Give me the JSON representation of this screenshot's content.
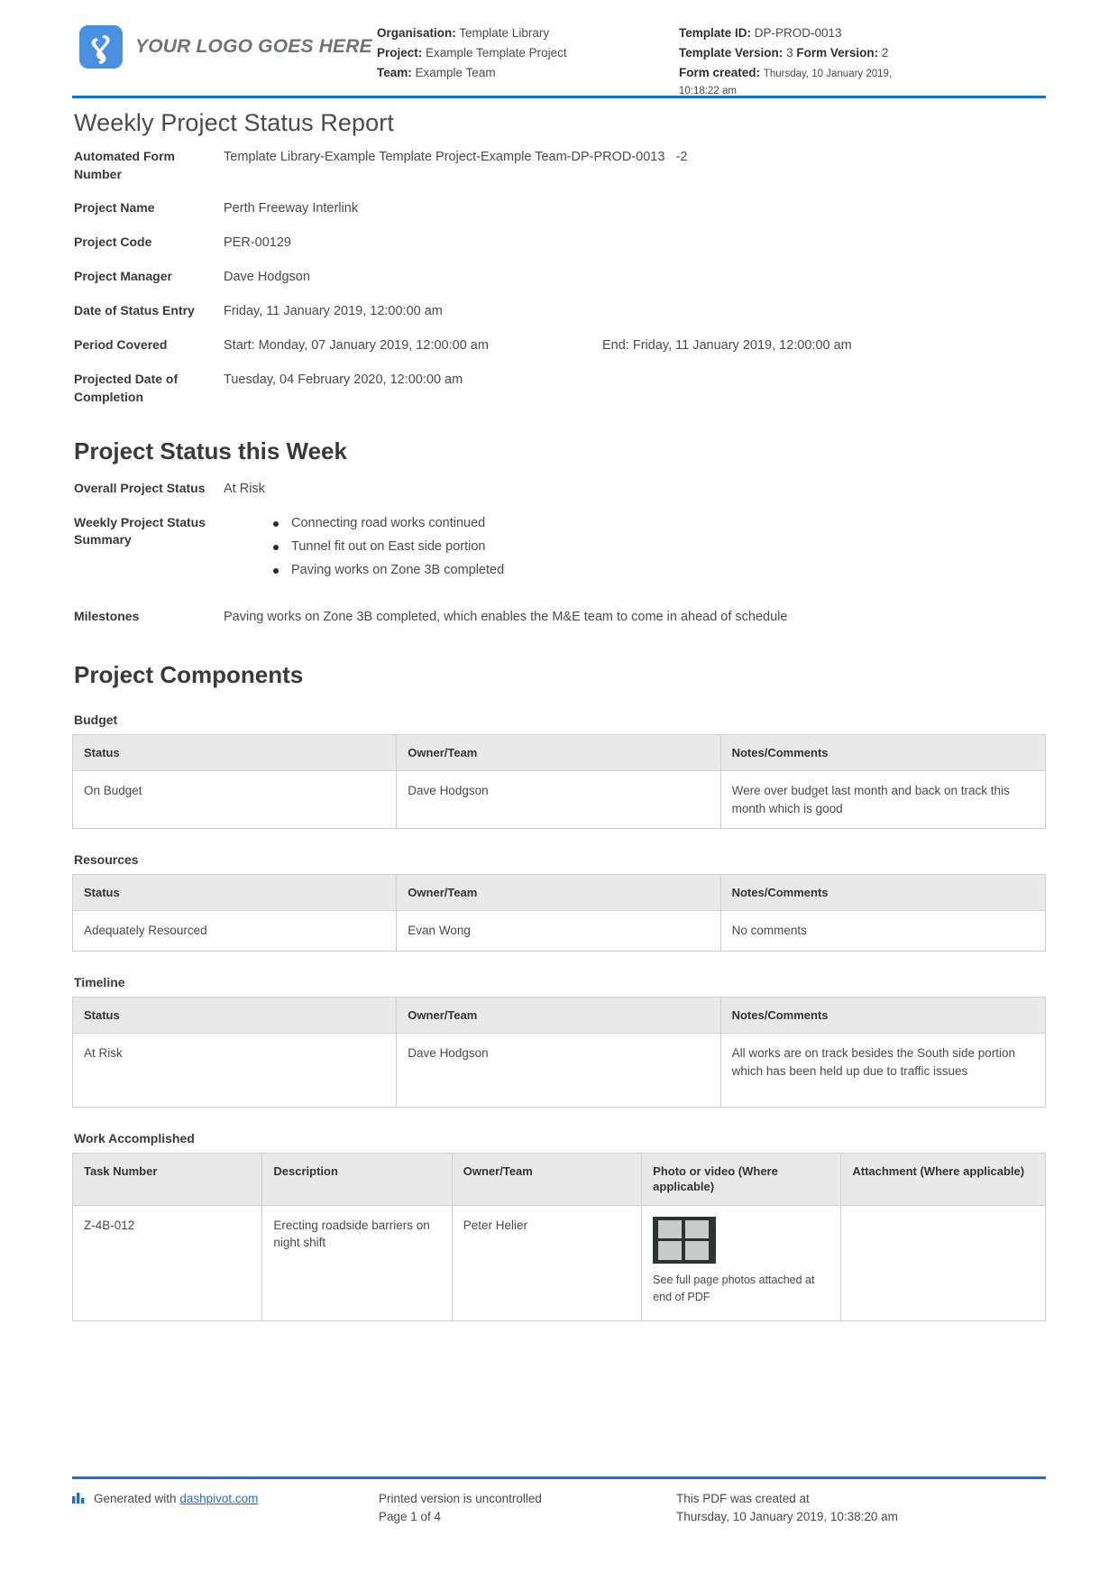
{
  "header": {
    "logo_text": "YOUR LOGO GOES HERE",
    "organisation_label": "Organisation:",
    "organisation_value": "Template Library",
    "project_label": "Project:",
    "project_value": "Example Template Project",
    "team_label": "Team:",
    "team_value": "Example Team",
    "template_id_label": "Template ID:",
    "template_id_value": "DP-PROD-0013",
    "template_version_label": "Template Version:",
    "template_version_value": "3",
    "form_version_label": "Form Version:",
    "form_version_value": "2",
    "form_created_label": "Form created:",
    "form_created_value": "Thursday, 10 January 2019,",
    "form_created_time": "10:18:22 am"
  },
  "title": "Weekly Project Status Report",
  "fields": {
    "automated_form_number_label": "Automated Form Number",
    "automated_form_number_value": "Template Library-Example Template Project-Example Team-DP-PROD-0013",
    "automated_form_number_suffix": "-2",
    "project_name_label": "Project Name",
    "project_name_value": "Perth Freeway Interlink",
    "project_code_label": "Project Code",
    "project_code_value": "PER-00129",
    "project_manager_label": "Project Manager",
    "project_manager_value": "Dave Hodgson",
    "date_of_status_entry_label": "Date of Status Entry",
    "date_of_status_entry_value": "Friday, 11 January 2019, 12:00:00 am",
    "period_covered_label": "Period Covered",
    "period_covered_start": "Start: Monday, 07 January 2019, 12:00:00 am",
    "period_covered_end": "End: Friday, 11 January 2019, 12:00:00 am",
    "projected_completion_label": "Projected Date of Completion",
    "projected_completion_value": "Tuesday, 04 February 2020, 12:00:00 am"
  },
  "status_section": {
    "heading": "Project Status this Week",
    "overall_status_label": "Overall Project Status",
    "overall_status_value": "At Risk",
    "weekly_summary_label": "Weekly Project Status Summary",
    "weekly_summary_bullets": [
      "Connecting road works continued",
      "Tunnel fit out on East side portion",
      "Paving works on Zone 3B completed"
    ],
    "milestones_label": "Milestones",
    "milestones_value": "Paving works on Zone 3B completed, which enables the M&E team to come in ahead of schedule"
  },
  "components_section": {
    "heading": "Project Components",
    "budget": {
      "label": "Budget",
      "columns": [
        "Status",
        "Owner/Team",
        "Notes/Comments"
      ],
      "rows": [
        {
          "status": "On Budget",
          "owner": "Dave Hodgson",
          "notes": "Were over budget last month and back on track this month which is good"
        }
      ]
    },
    "resources": {
      "label": "Resources",
      "columns": [
        "Status",
        "Owner/Team",
        "Notes/Comments"
      ],
      "rows": [
        {
          "status": "Adequately Resourced",
          "owner": "Evan Wong",
          "notes": "No comments"
        }
      ]
    },
    "timeline": {
      "label": "Timeline",
      "columns": [
        "Status",
        "Owner/Team",
        "Notes/Comments"
      ],
      "rows": [
        {
          "status": "At Risk",
          "owner": "Dave Hodgson",
          "notes": "All works are on track besides the South side portion which has been held up due to traffic issues"
        }
      ]
    },
    "work_accomplished": {
      "label": "Work Accomplished",
      "columns": [
        "Task Number",
        "Description",
        "Owner/Team",
        "Photo or video (Where applicable)",
        "Attachment (Where applicable)"
      ],
      "rows": [
        {
          "task_number": "Z-4B-012",
          "description": "Erecting roadside barriers on night shift",
          "owner": "Peter Helier",
          "photo_caption": "See full page photos attached at end of PDF",
          "attachment": ""
        }
      ]
    }
  },
  "footer": {
    "generated_prefix": "Generated with",
    "generated_link": "dashpivot.com",
    "uncontrolled_text": "Printed version is uncontrolled",
    "page_text": "Page 1 of 4",
    "created_text": "This PDF was created at",
    "created_datetime": "Thursday, 10 January 2019, 10:38:20 am"
  },
  "colors": {
    "accent_blue": "#1a6fd4",
    "logo_blue": "#4a90e2",
    "table_header_gray": "#e9e9e9"
  }
}
